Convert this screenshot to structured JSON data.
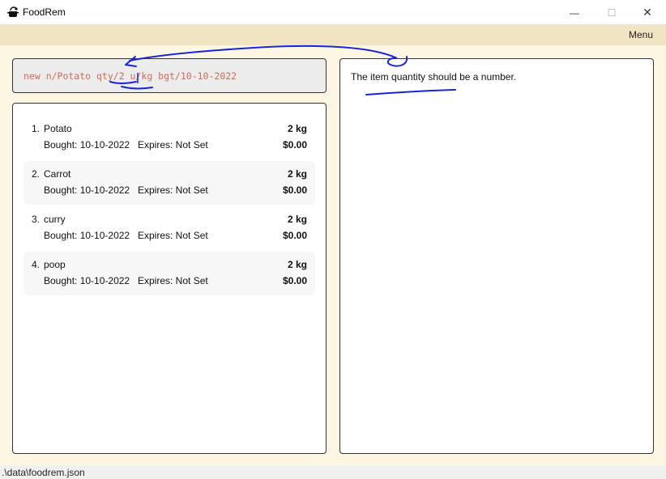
{
  "window": {
    "title": "FoodRem",
    "minimize": "—",
    "maximize": "☐",
    "close": "✕"
  },
  "menubar": {
    "menu_label": "Menu"
  },
  "command": {
    "text": "new n/Potato qty/2 u/kg bgt/10-10-2022"
  },
  "result": {
    "message": "The item quantity should be a number."
  },
  "items": [
    {
      "index": "1.",
      "name": "Potato",
      "quantity": "2 kg",
      "bought": "Bought: 10-10-2022",
      "expires": "Expires: Not Set",
      "price": "$0.00"
    },
    {
      "index": "2.",
      "name": "Carrot",
      "quantity": "2 kg",
      "bought": "Bought: 10-10-2022",
      "expires": "Expires: Not Set",
      "price": "$0.00"
    },
    {
      "index": "3.",
      "name": "curry",
      "quantity": "2 kg",
      "bought": "Bought: 10-10-2022",
      "expires": "Expires: Not Set",
      "price": "$0.00"
    },
    {
      "index": "4.",
      "name": "poop",
      "quantity": "2 kg",
      "bought": "Bought: 10-10-2022",
      "expires": "Expires: Not Set",
      "price": "$0.00"
    }
  ],
  "status": {
    "path": ".\\data\\foodrem.json"
  },
  "colors": {
    "accent": "#f1e4c3",
    "background": "#fdf6e3",
    "command_text": "#cf6b57",
    "annotation": "#1a24d6"
  },
  "icons": {
    "app": "chef-pot-icon"
  }
}
